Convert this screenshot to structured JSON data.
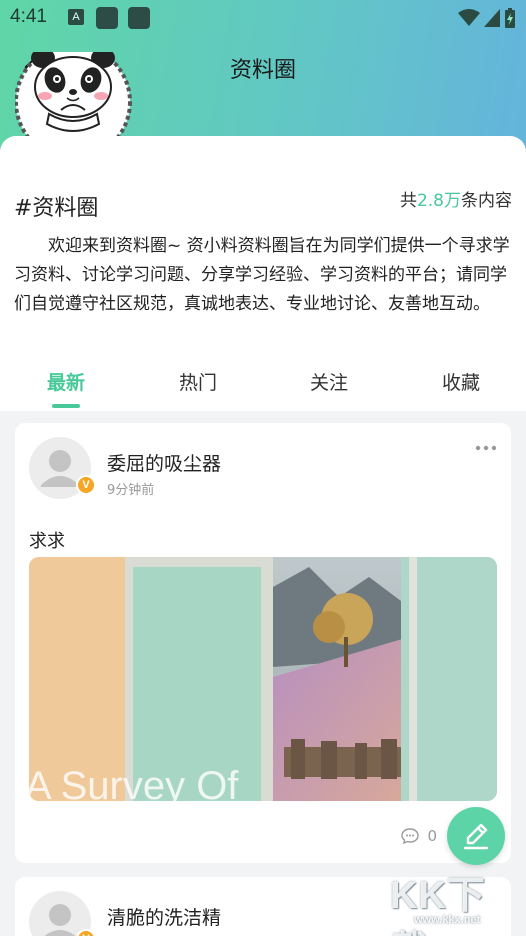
{
  "status_bar": {
    "time": "4:41",
    "a_icon_letter": "A"
  },
  "nav": {
    "title": "资料圈",
    "back_icon": "chevron-left-icon"
  },
  "circle": {
    "name": "#资料圈",
    "count_prefix": "共",
    "count_value": "2.8万",
    "count_suffix": "条内容",
    "description": "欢迎来到资料圈~ 资小料资料圈旨在为同学们提供一个寻求学习资料、讨论学习问题、分享学习经验、学习资料的平台；请同学们自觉遵守社区规范，真诚地表达、专业地讨论、友善地互动。"
  },
  "tabs": [
    {
      "label": "最新",
      "active": true
    },
    {
      "label": "热门",
      "active": false
    },
    {
      "label": "关注",
      "active": false
    },
    {
      "label": "收藏",
      "active": false
    }
  ],
  "posts": [
    {
      "author": "委屈的吸尘器",
      "time": "9分钟前",
      "text": "求求",
      "badge": "V",
      "image_caption": "A Survey Of",
      "comment_count": "0"
    },
    {
      "author": "清脆的洗洁精",
      "badge": "V"
    }
  ],
  "colors": {
    "accent": "#47c99a",
    "header_start": "#5fd6a6",
    "header_end": "#64b4dc",
    "badge": "#f5a623"
  },
  "watermark": {
    "text": "KK下载",
    "url": "www.kkx.net"
  }
}
